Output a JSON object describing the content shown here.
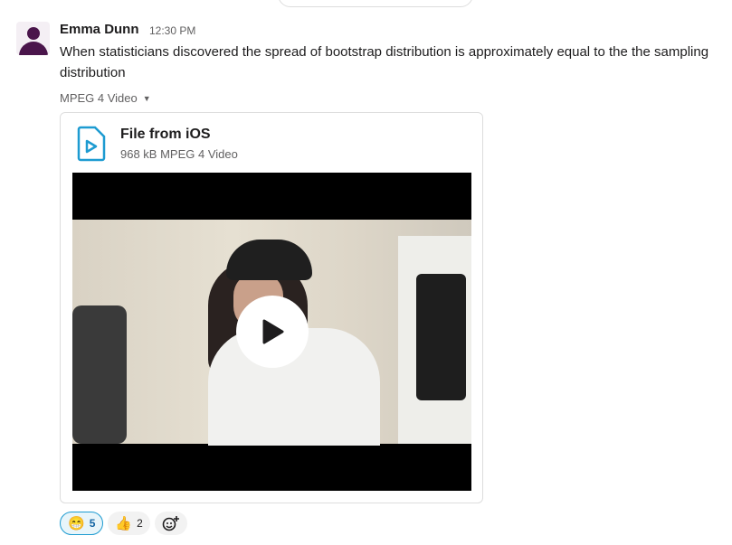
{
  "message": {
    "author": "Emma Dunn",
    "time": "12:30 PM",
    "text": "When statisticians discovered the spread of bootstrap distribution is approximately equal to the the sampling distribution",
    "file_type_label": "MPEG 4 Video"
  },
  "file": {
    "title": "File from iOS",
    "meta": "968 kB MPEG 4 Video",
    "accent": "#1d9bd1"
  },
  "reactions": [
    {
      "emoji": "😁",
      "icon": "grinning-face-icon",
      "count": "5",
      "active": true
    },
    {
      "emoji": "👍",
      "icon": "thumbs-up-icon",
      "count": "2",
      "active": false
    }
  ]
}
